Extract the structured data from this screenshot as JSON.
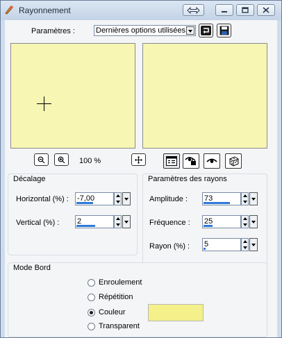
{
  "window": {
    "title": "Rayonnement"
  },
  "params": {
    "label": "Paramètres :",
    "preset_value": "Dernières options utilisées"
  },
  "preview": {
    "zoom": "100 %"
  },
  "decalage": {
    "title": "Décalage",
    "horizontal_label": "Horizontal (%) :",
    "horizontal_value": "-7,00",
    "horizontal_level": 0.46,
    "vertical_label": "Vertical (%) :",
    "vertical_value": "2",
    "vertical_level": 0.51
  },
  "rayons": {
    "title": "Paramètres des rayons",
    "amplitude_label": "Amplitude :",
    "amplitude_value": "73",
    "amplitude_level": 0.73,
    "frequence_label": "Fréquence :",
    "frequence_value": "25",
    "frequence_level": 0.25,
    "rayon_label": "Rayon (%) :",
    "rayon_value": "5",
    "rayon_level": 0.05
  },
  "mode_bord": {
    "title": "Mode Bord",
    "options": [
      "Enroulement",
      "Répétition",
      "Couleur",
      "Transparent"
    ],
    "selected": "Couleur",
    "color": "#f4f08a"
  },
  "colors": {
    "preview_bg": "#f8f6b3",
    "accent": "#2f79d8",
    "titlebar": "#cfdced"
  }
}
